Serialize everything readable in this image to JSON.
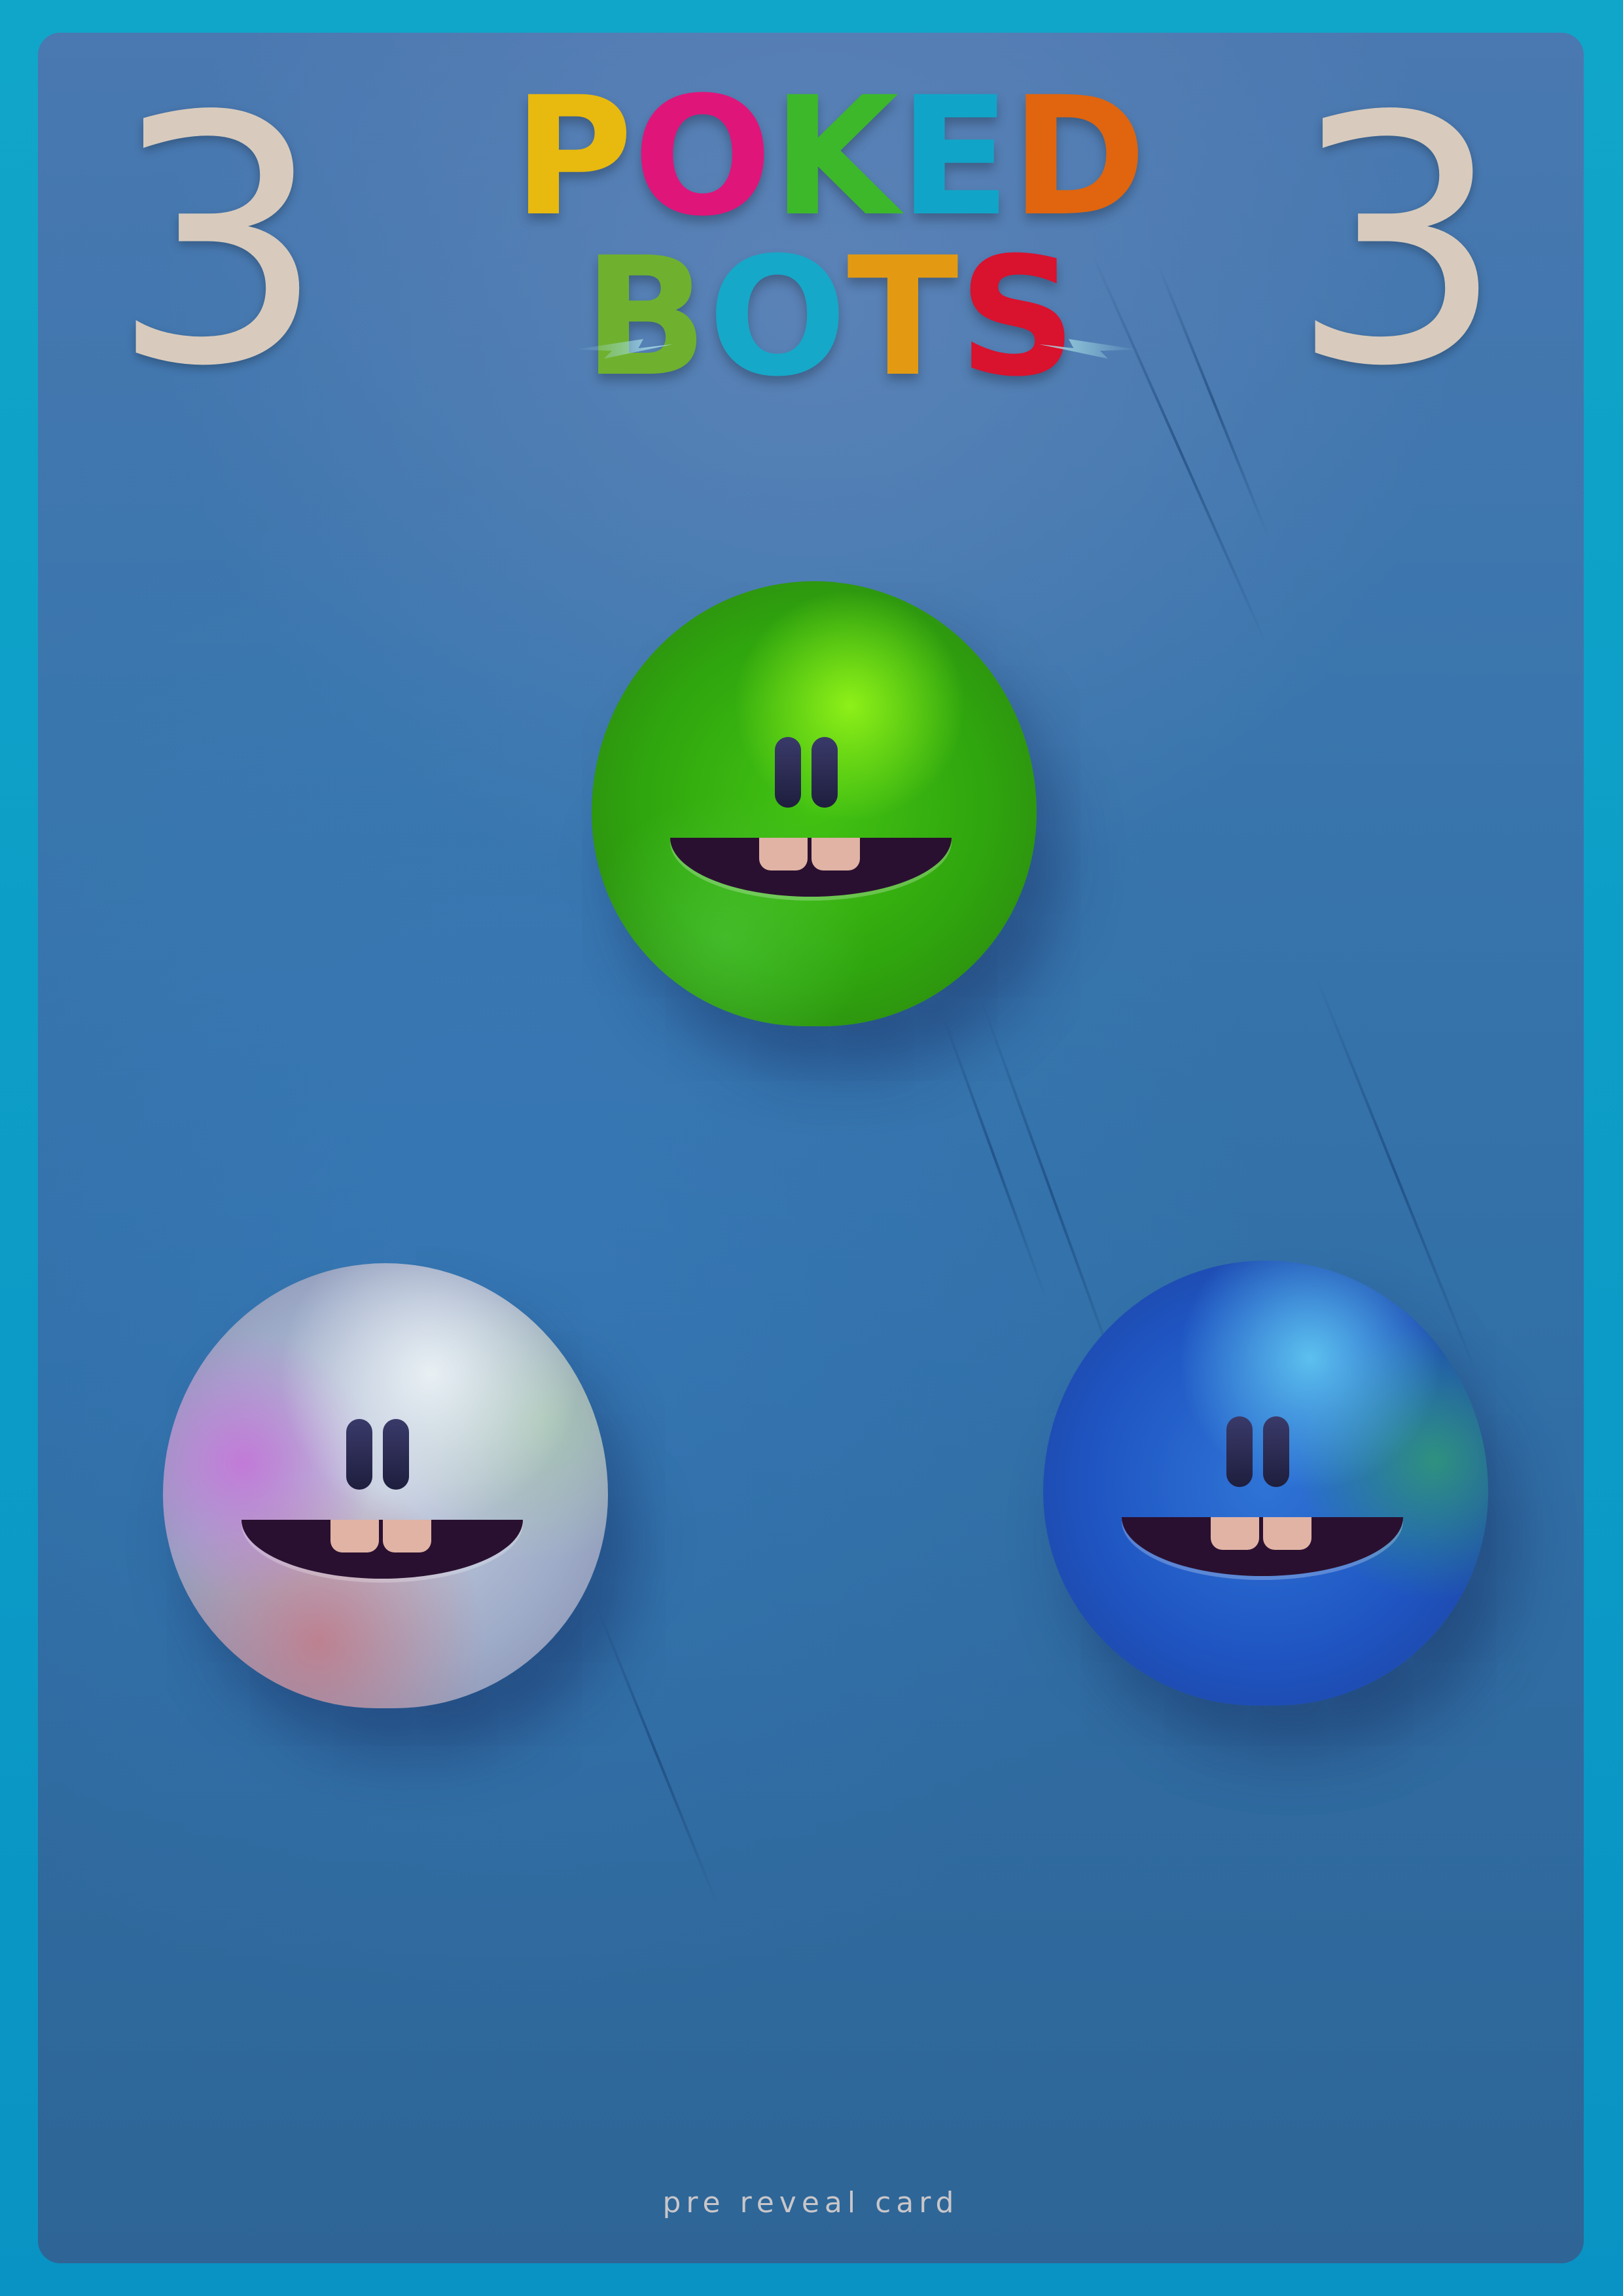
{
  "card": {
    "count_left": "3",
    "count_right": "3",
    "footer_text": "pre reveal card"
  },
  "logo": {
    "row1": [
      {
        "char": "P",
        "color": "#e8b90e"
      },
      {
        "char": "O",
        "color": "#e01579"
      },
      {
        "char": "K",
        "color": "#3db82a"
      },
      {
        "char": "E",
        "color": "#10a5c8"
      },
      {
        "char": "D",
        "color": "#e0650e"
      }
    ],
    "row2": [
      {
        "char": "B",
        "color": "#6fb12e"
      },
      {
        "char": "O",
        "color": "#16a8c8"
      },
      {
        "char": "T",
        "color": "#e39a12"
      },
      {
        "char": "S",
        "color": "#d9122e"
      }
    ]
  },
  "bots": [
    {
      "name": "green-bot",
      "color": "#3db818"
    },
    {
      "name": "white-bot",
      "color": "#c2cbe0"
    },
    {
      "name": "blue-bot",
      "color": "#2561cc"
    }
  ],
  "colors": {
    "background": "#0ea2c8",
    "card": "#3773ab",
    "count": "#d8cbbd"
  }
}
